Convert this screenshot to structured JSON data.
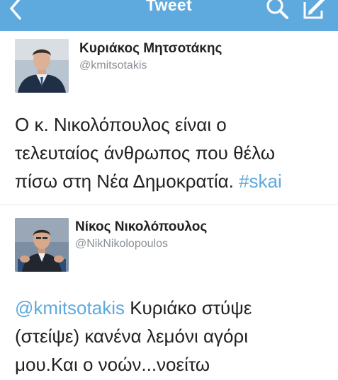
{
  "header": {
    "title": "Tweet",
    "background": "#5ea9dd",
    "icons": [
      "back-icon",
      "search-icon",
      "compose-icon"
    ]
  },
  "tweets": [
    {
      "display_name": "Κυριάκος Μητσοτάκης",
      "handle": "@kmitsotakis",
      "text_lines": [
        "Ο κ. Νικολόπουλος είναι ο",
        "τελευταίος άνθρωπος που θέλω",
        "πίσω στη Νέα Δημοκρατία. "
      ],
      "hashtag": "#skai"
    },
    {
      "display_name": "Νίκος Νικολόπουλος",
      "handle": "@NikNikolopoulos",
      "mention": "@kmitsotakis",
      "text_lines": [
        " Κυριάκο στύψε",
        "(στείψε) κανένα λεμόνι αγόρι",
        "μου.Και ο νοών...νοείτω"
      ]
    }
  ],
  "link_color": "#5ea9dd"
}
